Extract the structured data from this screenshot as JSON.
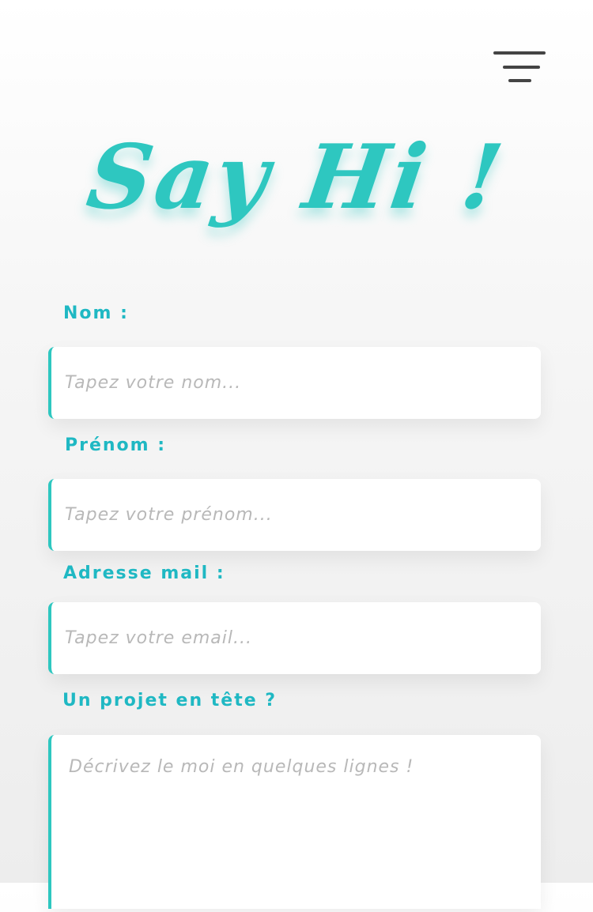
{
  "header": {
    "menu_icon": "hamburger-menu-icon"
  },
  "hero": {
    "title": "Say Hi !",
    "accent_color": "#2ec7c0"
  },
  "form": {
    "nom": {
      "label": "Nom :",
      "placeholder": "Tapez votre nom..."
    },
    "prenom": {
      "label": "Prénom :",
      "placeholder": "Tapez votre prénom..."
    },
    "email": {
      "label": "Adresse mail :",
      "placeholder": "Tapez votre email..."
    },
    "projet": {
      "label": "Un projet en tête ?",
      "placeholder": "Décrivez le moi en quelques lignes !"
    },
    "label_color": "#1fb8c3"
  }
}
